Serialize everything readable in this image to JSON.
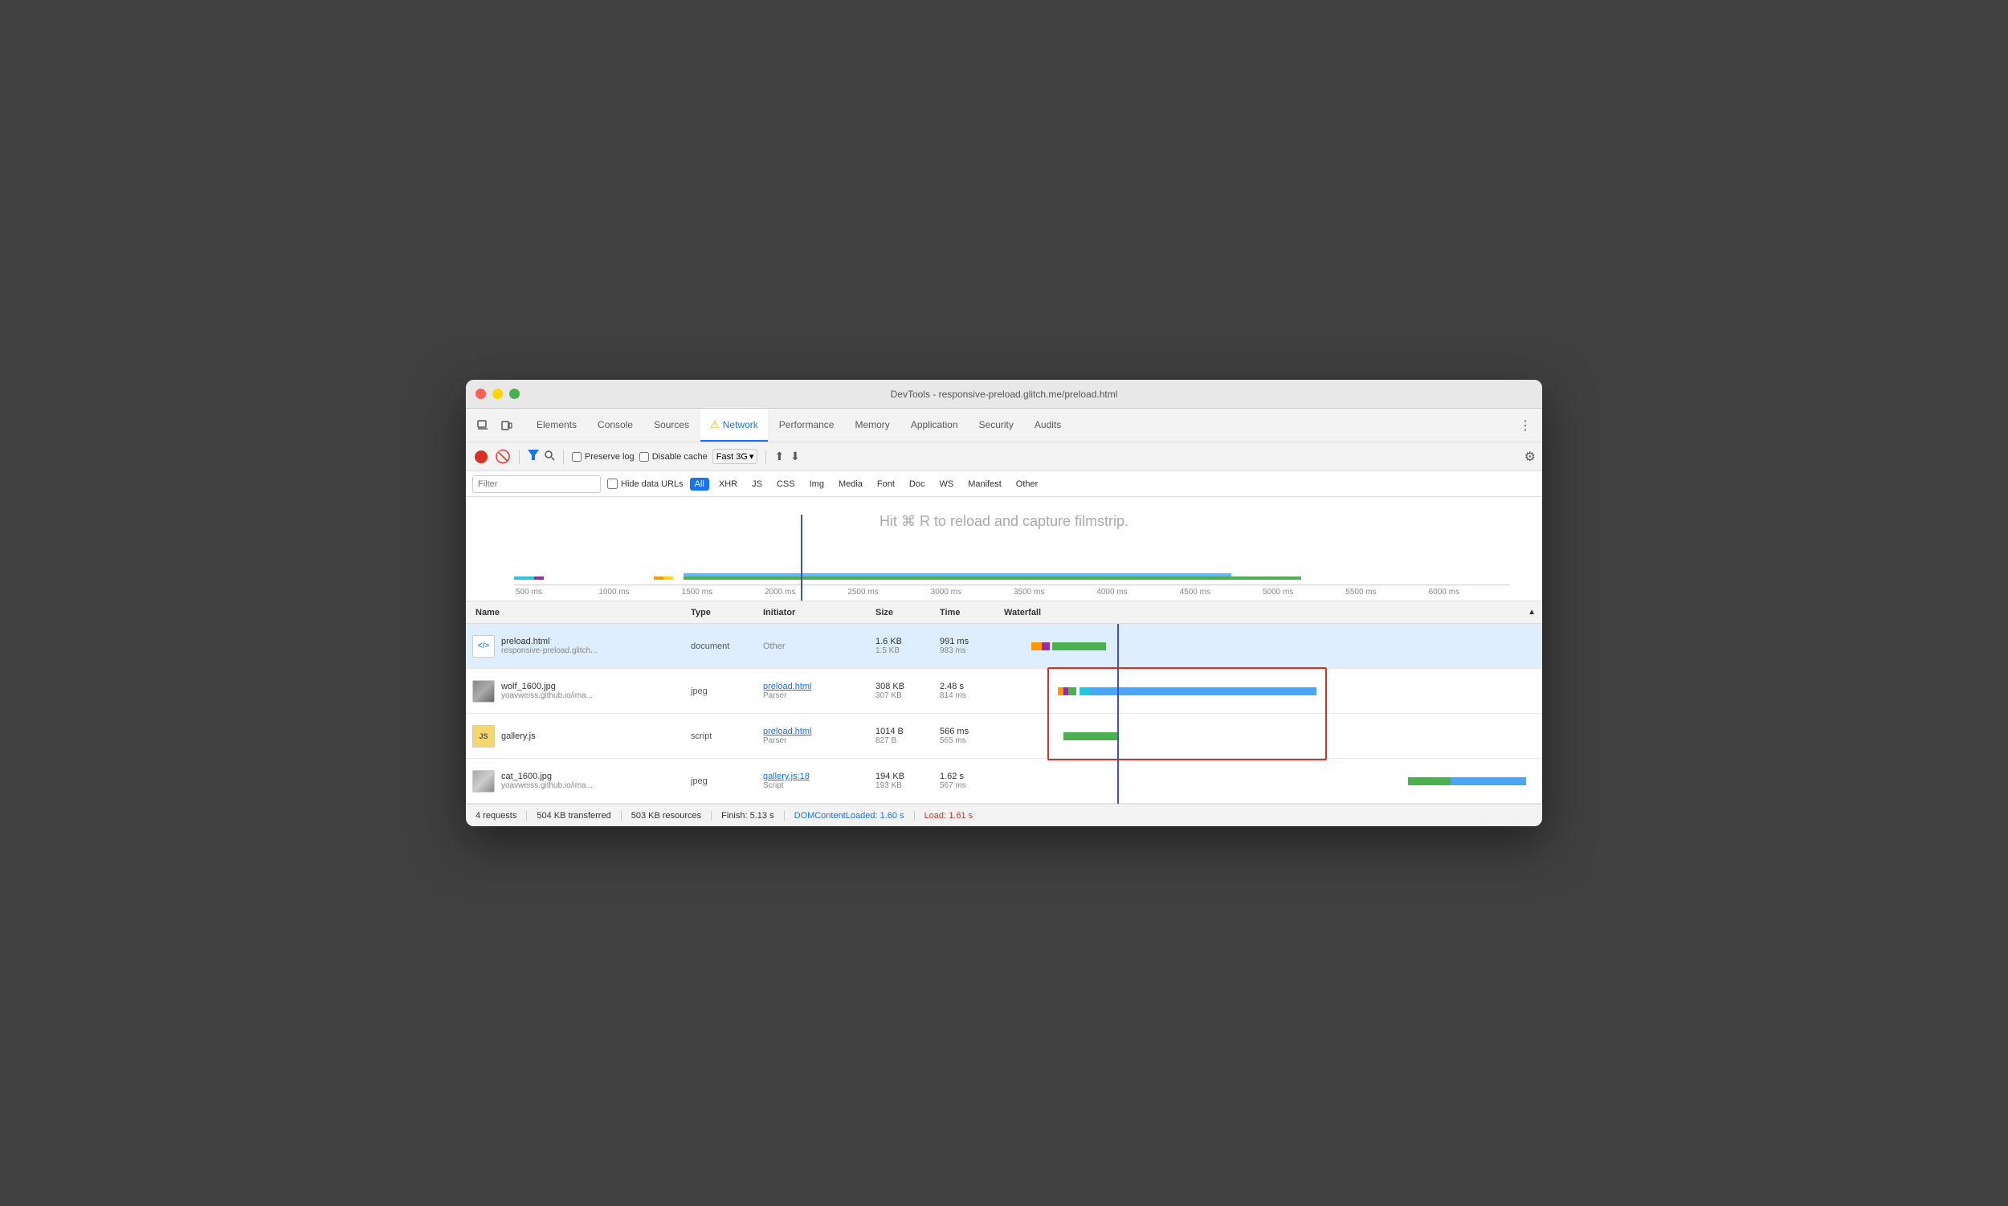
{
  "window": {
    "title": "DevTools - responsive-preload.glitch.me/preload.html"
  },
  "tabs": {
    "items": [
      {
        "label": "Elements",
        "active": false
      },
      {
        "label": "Console",
        "active": false
      },
      {
        "label": "Sources",
        "active": false
      },
      {
        "label": "Network",
        "active": true,
        "warning": true
      },
      {
        "label": "Performance",
        "active": false
      },
      {
        "label": "Memory",
        "active": false
      },
      {
        "label": "Application",
        "active": false
      },
      {
        "label": "Security",
        "active": false
      },
      {
        "label": "Audits",
        "active": false
      }
    ]
  },
  "toolbar": {
    "preserve_log_label": "Preserve log",
    "disable_cache_label": "Disable cache",
    "throttle_label": "Fast 3G",
    "settings_label": "Settings"
  },
  "filter": {
    "placeholder": "Filter",
    "hide_data_urls_label": "Hide data URLs",
    "tags": [
      "All",
      "XHR",
      "JS",
      "CSS",
      "Img",
      "Media",
      "Font",
      "Doc",
      "WS",
      "Manifest",
      "Other"
    ]
  },
  "hint": {
    "text": "Hit ⌘ R to reload and capture filmstrip."
  },
  "time_ruler": {
    "marks": [
      "500 ms",
      "1000 ms",
      "1500 ms",
      "2000 ms",
      "2500 ms",
      "3000 ms",
      "3500 ms",
      "4000 ms",
      "4500 ms",
      "5000 ms",
      "5500 ms",
      "6000 ms"
    ]
  },
  "table": {
    "headers": [
      "Name",
      "Type",
      "Initiator",
      "Size",
      "Time",
      "Waterfall"
    ],
    "rows": [
      {
        "filename": "preload.html",
        "url": "responsive-preload.glitch...",
        "type": "document",
        "initiator": "Other",
        "initiator_link": null,
        "initiator_sub": null,
        "size1": "1.6 KB",
        "size2": "1.5 KB",
        "time1": "991 ms",
        "time2": "983 ms",
        "icon_type": "doc",
        "selected": true
      },
      {
        "filename": "wolf_1600.jpg",
        "url": "yoavweiss.github.io/ima...",
        "type": "jpeg",
        "initiator": "preload.html",
        "initiator_link": true,
        "initiator_sub": "Parser",
        "size1": "308 KB",
        "size2": "307 KB",
        "time1": "2.48 s",
        "time2": "814 ms",
        "icon_type": "img",
        "selected": false
      },
      {
        "filename": "gallery.js",
        "url": "",
        "type": "script",
        "initiator": "preload.html",
        "initiator_link": true,
        "initiator_sub": "Parser",
        "size1": "1014 B",
        "size2": "827 B",
        "time1": "566 ms",
        "time2": "565 ms",
        "icon_type": "js",
        "selected": false
      },
      {
        "filename": "cat_1600.jpg",
        "url": "yoavweiss.github.io/ima...",
        "type": "jpeg",
        "initiator": "gallery.js:18",
        "initiator_link": true,
        "initiator_sub": "Script",
        "size1": "194 KB",
        "size2": "193 KB",
        "time1": "1.62 s",
        "time2": "567 ms",
        "icon_type": "img2",
        "selected": false
      }
    ]
  },
  "status_bar": {
    "requests": "4 requests",
    "transferred": "504 KB transferred",
    "resources": "503 KB resources",
    "finish": "Finish: 5.13 s",
    "dom_loaded": "DOMContentLoaded: 1.60 s",
    "load": "Load: 1.61 s"
  }
}
